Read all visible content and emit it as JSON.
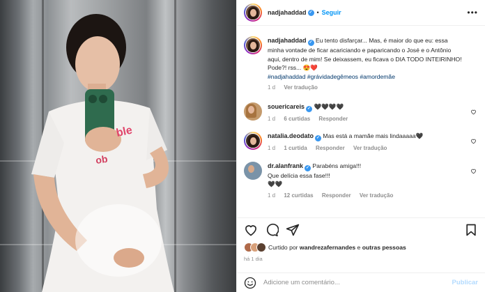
{
  "post": {
    "username": "nadjahaddad",
    "follow_label": "Seguir",
    "dot": "•",
    "more_label": "•••"
  },
  "caption": {
    "username": "nadjahaddad",
    "text": "Eu tento disfarçar... Mas, é maior do que eu: essa minha vontade de ficar acariciando e paparicando o José e o Antônio aqui, dentro de mim! Se deixassem, eu ficava o DIA TODO INTEIRINHO! Pode?! rss... 😍❤️",
    "hashtags": "#nadjahaddad #grávidadegêmeos #amordemãe",
    "time": "1 d",
    "translate": "Ver tradução"
  },
  "comments": [
    {
      "username": "souericareis",
      "text": "🖤🖤🖤🖤",
      "time": "1 d",
      "likes": "6 curtidas",
      "reply": "Responder",
      "translate": "",
      "avatar_color": "#c49a6c"
    },
    {
      "username": "natalia.deodato",
      "text": "Mas está a mamãe mais lindaaaaa🖤",
      "time": "1 d",
      "likes": "1 curtida",
      "reply": "Responder",
      "translate": "Ver tradução",
      "avatar_color": "#3b2a24"
    },
    {
      "username": "dr.alanfrank",
      "text": "Parabéns amiga!!!\nQue delícia essa fase!!!\n🖤🖤",
      "time": "1 d",
      "likes": "12 curtidas",
      "reply": "Responder",
      "translate": "Ver tradução",
      "avatar_color": "#7a93a8"
    }
  ],
  "likes": {
    "prefix": "Curtido por",
    "user": "wandrezafernandes",
    "middle": "e",
    "others": "outras pessoas",
    "avatar_colors": [
      "#b06a4a",
      "#d8a07a",
      "#5a4030"
    ]
  },
  "posted_ago": "há 1 dia",
  "comment_box": {
    "placeholder": "Adicione um comentário...",
    "publish_label": "Publicar"
  },
  "colors": {
    "accent": "#0095f6",
    "verified": "#3897f0",
    "muted": "#8e8e8e",
    "hashtag": "#00376b"
  },
  "icons": [
    "heart-icon",
    "comment-icon",
    "share-icon",
    "bookmark-icon",
    "emoji-icon",
    "verified-icon",
    "more-icon"
  ]
}
